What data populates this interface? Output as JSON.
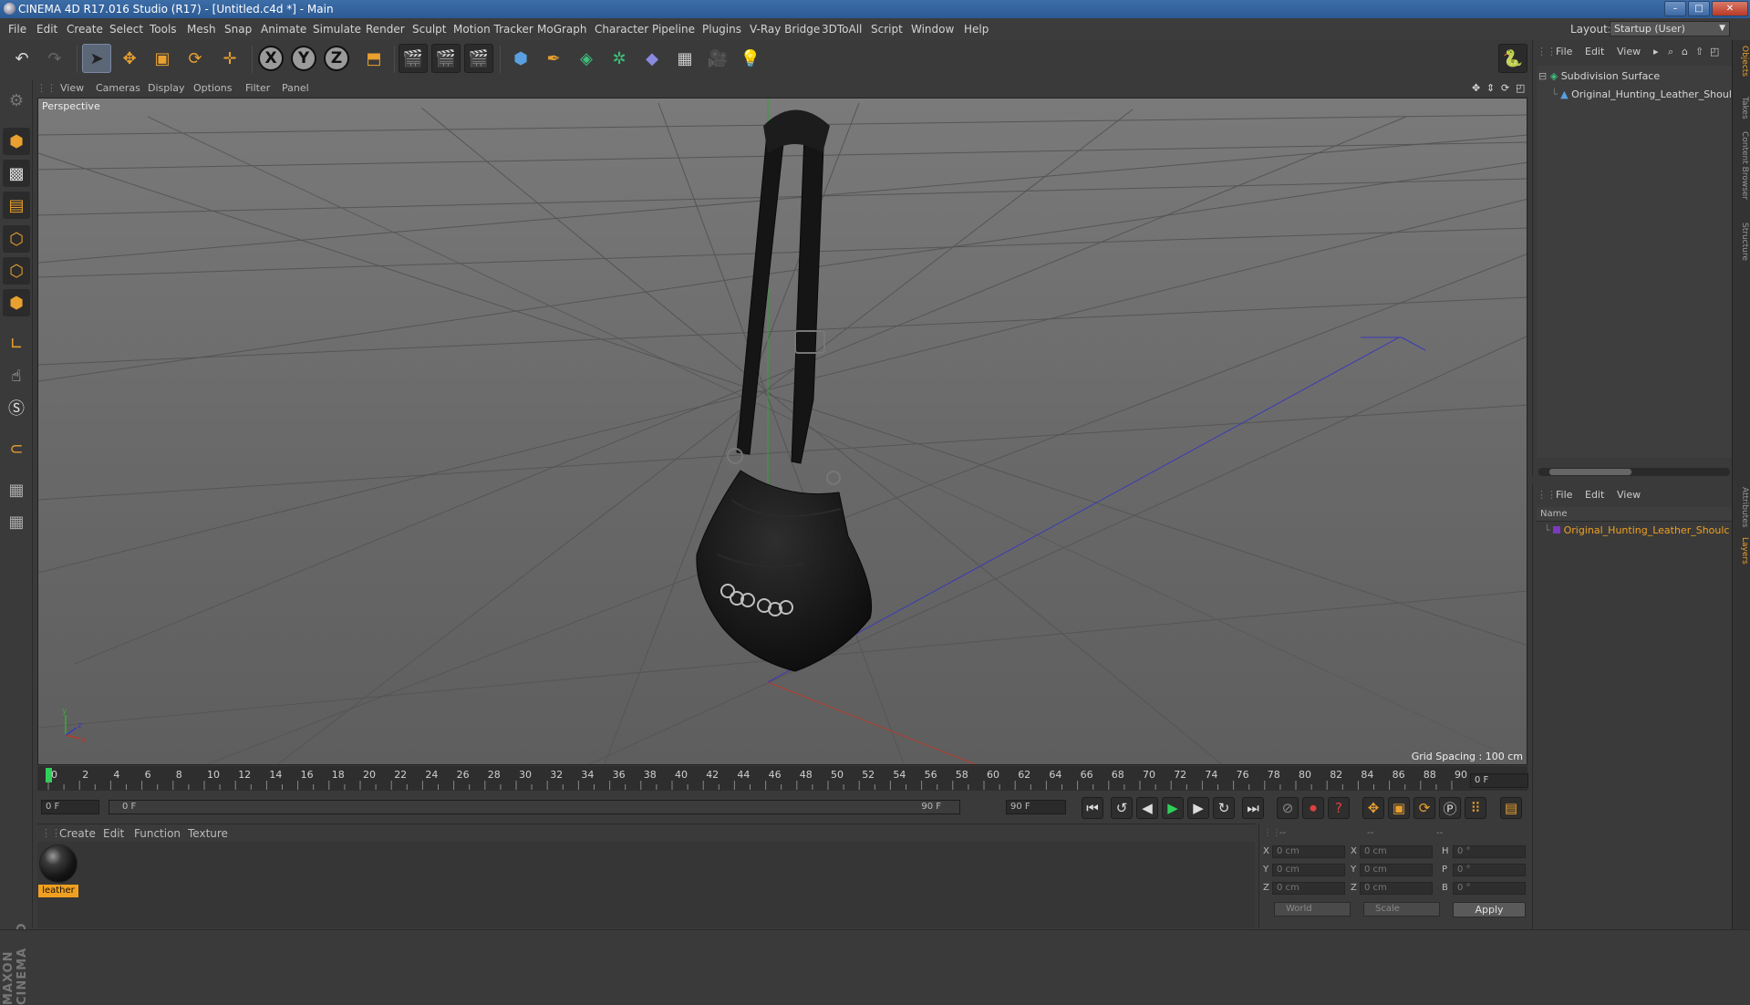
{
  "window": {
    "title": "CINEMA 4D R17.016 Studio (R17) - [Untitled.c4d *] - Main",
    "min": "–",
    "max": "□",
    "close": "✕"
  },
  "menubar": {
    "items": [
      "File",
      "Edit",
      "Create",
      "Select",
      "Tools",
      "Mesh",
      "Snap",
      "Animate",
      "Simulate",
      "Render",
      "Sculpt",
      "Motion Tracker",
      "MoGraph",
      "Character",
      "Pipeline",
      "Plugins",
      "V-Ray Bridge",
      "3DToAll",
      "Script",
      "Window",
      "Help"
    ],
    "layout_label": "Layout:",
    "layout_value": "Startup (User)"
  },
  "toolbar": {
    "axis_x": "X",
    "axis_y": "Y",
    "axis_z": "Z"
  },
  "viewport": {
    "menu": [
      "View",
      "Cameras",
      "Display",
      "Options",
      "Filter",
      "Panel"
    ],
    "label": "Perspective",
    "grid_spacing": "Grid Spacing : 100 cm"
  },
  "timeline": {
    "ticks": [
      "0",
      "2",
      "4",
      "6",
      "8",
      "10",
      "12",
      "14",
      "16",
      "18",
      "20",
      "22",
      "24",
      "26",
      "28",
      "30",
      "32",
      "34",
      "36",
      "38",
      "40",
      "42",
      "44",
      "46",
      "48",
      "50",
      "52",
      "54",
      "56",
      "58",
      "60",
      "62",
      "64",
      "66",
      "68",
      "70",
      "72",
      "74",
      "76",
      "78",
      "80",
      "82",
      "84",
      "86",
      "88",
      "90"
    ],
    "current_frame": "0 F"
  },
  "transport": {
    "start_field": "0 F",
    "range_start": "0 F",
    "range_end": "90 F",
    "end_field": "90 F"
  },
  "material_manager": {
    "menu": [
      "Create",
      "Edit",
      "Function",
      "Texture"
    ],
    "material_name": "leather"
  },
  "coordinates": {
    "header": [
      "--",
      "--",
      "--"
    ],
    "rows": [
      {
        "label": "X",
        "pos": "0 cm",
        "label2": "X",
        "size": "0 cm",
        "label3": "H",
        "rot": "0 °"
      },
      {
        "label": "Y",
        "pos": "0 cm",
        "label2": "Y",
        "size": "0 cm",
        "label3": "P",
        "rot": "0 °"
      },
      {
        "label": "Z",
        "pos": "0 cm",
        "label2": "Z",
        "size": "0 cm",
        "label3": "B",
        "rot": "0 °"
      }
    ],
    "mode": "World",
    "transform": "Scale",
    "apply": "Apply"
  },
  "object_manager": {
    "menu": [
      "File",
      "Edit",
      "View"
    ],
    "objects": [
      {
        "name": "Subdivision Surface",
        "color": "#d6d6d6"
      },
      {
        "name": "Original_Hunting_Leather_Shoul",
        "color": "#d6d6d6"
      }
    ]
  },
  "layer_manager": {
    "menu": [
      "File",
      "Edit",
      "View"
    ],
    "column_name": "Name",
    "layer": "Original_Hunting_Leather_Shoulc",
    "layer_color": "#f0a020"
  },
  "side_tabs": [
    "Objects",
    "Takes",
    "Content Browser",
    "Structure",
    "Attributes",
    "Layers"
  ],
  "logo": "MAXON CINEMA 4D"
}
